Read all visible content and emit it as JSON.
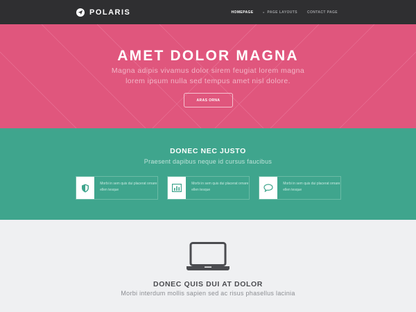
{
  "brand": {
    "name": "POLARIS",
    "icon": "paper-plane-icon"
  },
  "nav": {
    "items": [
      {
        "label": "HOMEPAGE",
        "active": true
      },
      {
        "label": "PAGE LAYOUTS",
        "active": false
      },
      {
        "label": "CONTACT PAGE",
        "active": false
      }
    ]
  },
  "hero": {
    "title": "AMET DOLOR MAGNA",
    "subtitle": "Magna adipis vivamus dolor sirem feugiat lorem magna lorem ipsum nulla sed tempus amet nisl dolore.",
    "button": "ARAS ORNA"
  },
  "features": {
    "title": "DONEC NEC JUSTO",
    "subtitle": "Praesent dapibus neque id cursus faucibus",
    "cards": [
      {
        "icon": "shield-icon",
        "text": "Morbi in sem quis dui placerat ornare ellen tesque"
      },
      {
        "icon": "bar-chart-icon",
        "text": "Morbi in sem quis dui placerat ornare ellen tesque"
      },
      {
        "icon": "speech-bubble-icon",
        "text": "Morbi in sem quis dui placerat ornare ellen tesque"
      }
    ]
  },
  "section3": {
    "icon": "laptop-icon",
    "title": "DONEC QUIS DUI AT DOLOR",
    "subtitle": "Morbi interdum mollis sapien sed ac risus phasellus lacinia"
  },
  "colors": {
    "nav_bg": "#2f2f31",
    "hero_bg": "#e0567d",
    "features_bg": "#3fa58d",
    "section3_bg": "#eff0f2"
  }
}
